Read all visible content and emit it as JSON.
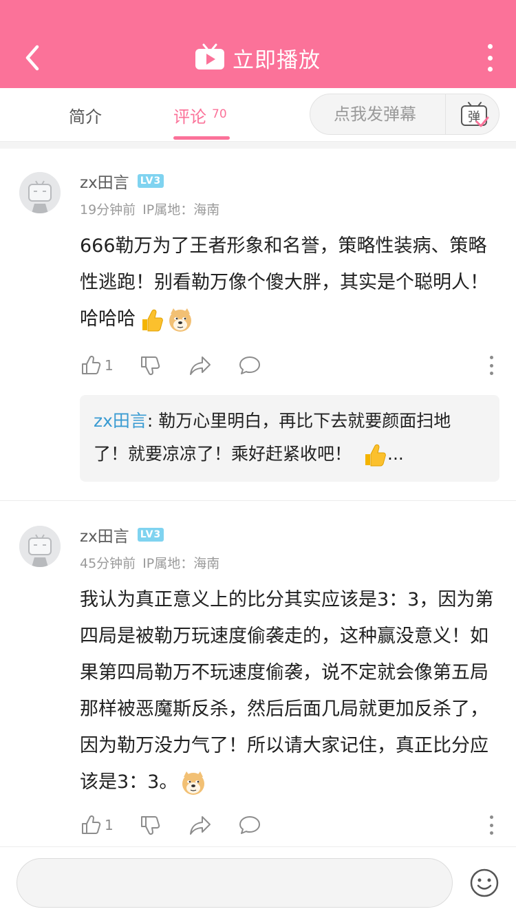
{
  "header": {
    "title": "立即播放",
    "back_icon": "chevron-left-icon",
    "tv_icon": "tv-play-icon",
    "more_icon": "more-vertical-icon",
    "bg_color": "#fb7299"
  },
  "tabs": {
    "intro_label": "简介",
    "comments_label": "评论",
    "comments_count": "70",
    "active": "评论"
  },
  "danmaku": {
    "placeholder": "点我发弹幕",
    "icon": "danmaku-toggle-icon",
    "icon_char": "弹"
  },
  "comments": [
    {
      "username": "zx田言",
      "level": "LV3",
      "time": "19分钟前",
      "ip": "IP属地：海南",
      "text": "666勒万为了王者形象和名誉，策略性装病、策略性逃跑！别看勒万像个傻大胖，其实是个聪明人！哈哈哈",
      "like_count": "1",
      "reply": {
        "user": "zx田言",
        "text": ": 勒万心里明白，再比下去就要颜面扫地了！就要凉凉了！乘好赶紧收吧！",
        "ellipsis": "..."
      }
    },
    {
      "username": "zx田言",
      "level": "LV3",
      "time": "45分钟前",
      "ip": "IP属地：海南",
      "text": "我认为真正意义上的比分其实应该是3：3，因为第四局是被勒万玩速度偷袭走的，这种赢没意义！如果第四局勒万不玩速度偷袭，说不定就会像第五局那样被恶魔斯反杀，然后后面几局就更加反杀了，因为勒万没力气了！所以请大家记住，真正比分应该是3：3。",
      "like_count": "1"
    }
  ],
  "input": {
    "placeholder": "",
    "emoji_icon": "smiley-icon"
  },
  "colors": {
    "accent": "#fb7299",
    "reply_user": "#3a9bd2",
    "level_badge": "#7fd3f0"
  }
}
